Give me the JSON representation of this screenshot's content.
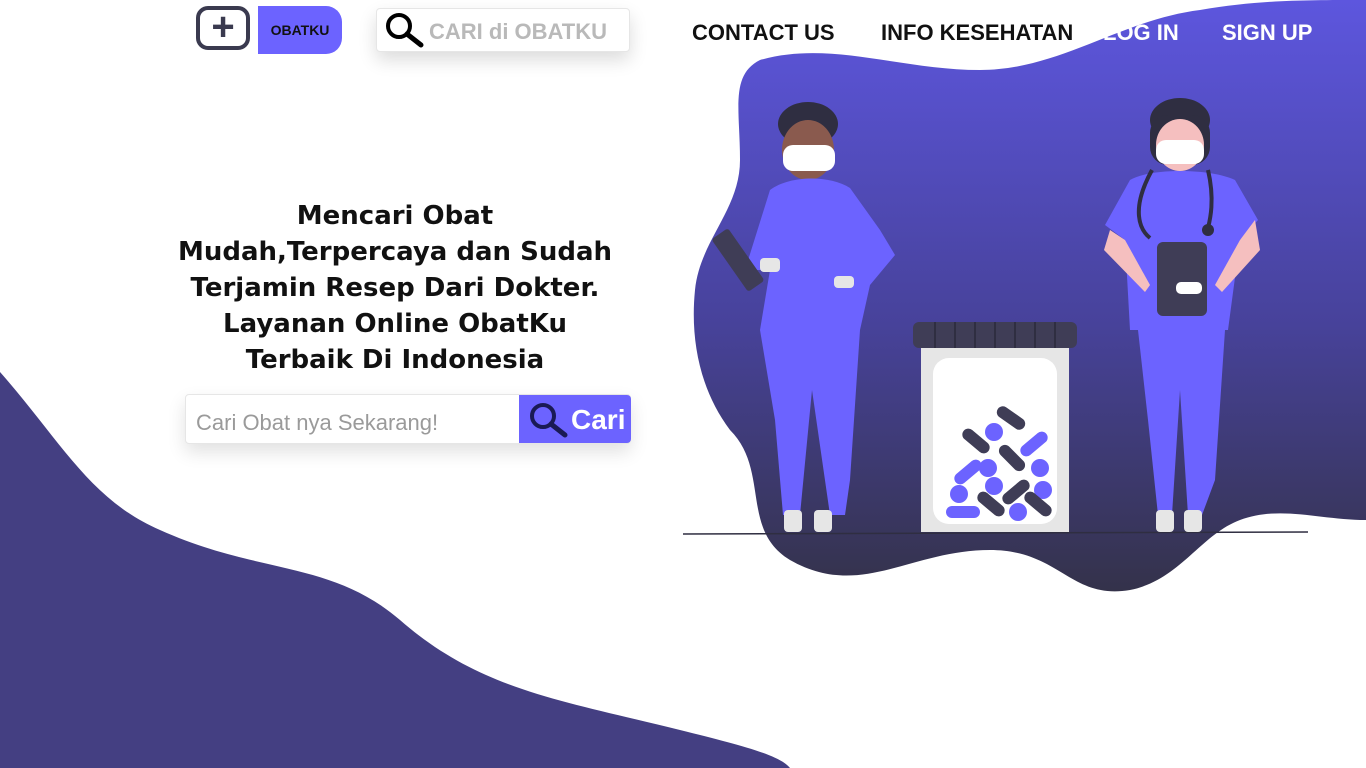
{
  "brand": {
    "logo_text": "OBATKU",
    "logo_symbol": "+"
  },
  "header": {
    "search_placeholder": "CARI di OBATKU",
    "nav": {
      "contact": "CONTACT US",
      "info": "INFO KESEHATAN",
      "login": "LOG IN",
      "signup": "SIGN UP"
    }
  },
  "hero": {
    "lines": [
      "Mencari Obat",
      "Mudah,Terpercaya dan Sudah",
      "Terjamin Resep Dari Dokter.",
      "Layanan Online ObatKu",
      "Terbaik Di Indonesia"
    ]
  },
  "main_search": {
    "placeholder": "Cari Obat nya Sekarang!",
    "button_label": "Cari"
  },
  "icons": {
    "search": "search-icon",
    "logo": "plus-icon"
  },
  "colors": {
    "accent": "#6c63ff",
    "dark_wave": "#443f82",
    "blob_top": "#5c55d8",
    "blob_bottom": "#3b3954",
    "nav_dark": "#111111",
    "nav_light": "#ffffff"
  }
}
